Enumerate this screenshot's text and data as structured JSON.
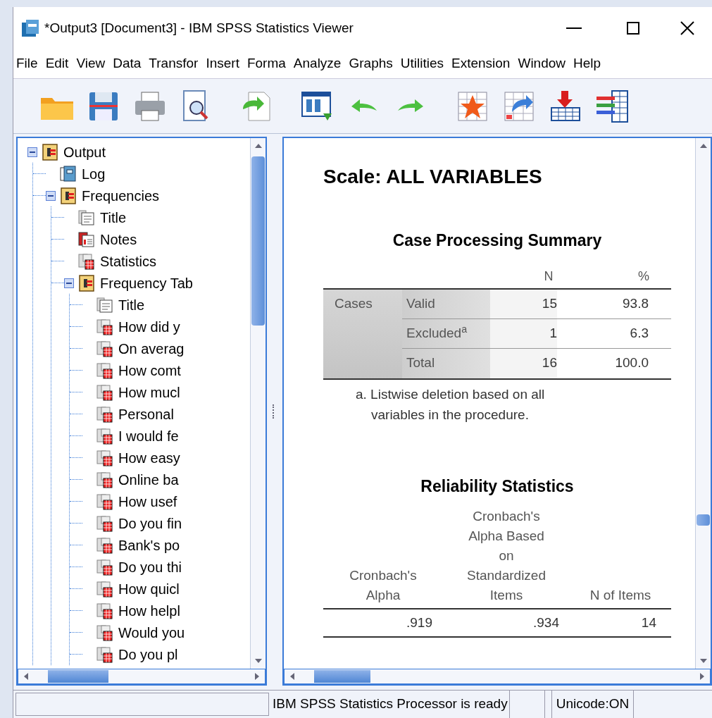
{
  "window": {
    "title": "*Output3 [Document3] - IBM SPSS Statistics Viewer"
  },
  "menu": [
    "File",
    "Edit",
    "View",
    "Data",
    "Transfor",
    "Insert",
    "Forma",
    "Analyze",
    "Graphs",
    "Utilities",
    "Extension",
    "Window",
    "Help"
  ],
  "tree": [
    {
      "label": "Output",
      "kind": "folder",
      "expanded": true,
      "children": [
        {
          "label": "Log",
          "kind": "log"
        },
        {
          "label": "Frequencies",
          "kind": "folder",
          "expanded": true,
          "children": [
            {
              "label": "Title",
              "kind": "title"
            },
            {
              "label": "Notes",
              "kind": "notes"
            },
            {
              "label": "Statistics",
              "kind": "table"
            },
            {
              "label": "Frequency Tab",
              "kind": "folder",
              "expanded": true,
              "children": [
                {
                  "label": "Title",
                  "kind": "title"
                },
                {
                  "label": "How did y",
                  "kind": "table"
                },
                {
                  "label": "On averag",
                  "kind": "table"
                },
                {
                  "label": "How comt",
                  "kind": "table"
                },
                {
                  "label": "How mucl",
                  "kind": "table"
                },
                {
                  "label": "Personal",
                  "kind": "table"
                },
                {
                  "label": "I would fe",
                  "kind": "table"
                },
                {
                  "label": "How easy",
                  "kind": "table"
                },
                {
                  "label": "Online ba",
                  "kind": "table"
                },
                {
                  "label": "How usef",
                  "kind": "table"
                },
                {
                  "label": "Do you fin",
                  "kind": "table"
                },
                {
                  "label": "Bank's po",
                  "kind": "table"
                },
                {
                  "label": "Do you thi",
                  "kind": "table"
                },
                {
                  "label": "How quicl",
                  "kind": "table"
                },
                {
                  "label": "How helpl",
                  "kind": "table"
                },
                {
                  "label": "Would you",
                  "kind": "table"
                },
                {
                  "label": "Do you pl",
                  "kind": "table"
                }
              ]
            }
          ]
        }
      ]
    }
  ],
  "output": {
    "heading": "Scale: ALL VARIABLES",
    "case_summary": {
      "title": "Case Processing Summary",
      "columns": [
        "N",
        "%"
      ],
      "group": "Cases",
      "rows": [
        {
          "label": "Valid",
          "n": "15",
          "pct": "93.8"
        },
        {
          "label": "Excluded$^{a}$",
          "n": "1",
          "pct": "6.3"
        },
        {
          "label": "Total",
          "n": "16",
          "pct": "100.0"
        }
      ],
      "footnote": [
        "a. Listwise deletion based on all",
        "variables in the procedure."
      ]
    },
    "reliability": {
      "title": "Reliability Statistics",
      "columns": [
        [
          "Cronbach's",
          "Alpha"
        ],
        [
          "Cronbach's",
          "Alpha Based",
          "on",
          "Standardized",
          "Items"
        ],
        [
          "N of Items"
        ]
      ],
      "values": [
        ".919",
        ".934",
        "14"
      ]
    }
  },
  "status_bar": {
    "message": "IBM SPSS Statistics Processor is ready",
    "encoding": "Unicode:ON"
  }
}
